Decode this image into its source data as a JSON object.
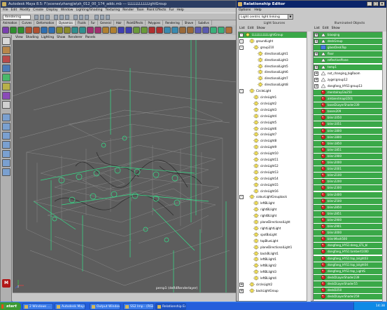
{
  "maya": {
    "title": "Autodesk Maya 8.5: F:\\scenes\\zhangjie\\sh_012_00_174_addc.mb  ---  LLLLLLLLLLLightGroup",
    "menus": [
      "File",
      "Edit",
      "Modify",
      "Create",
      "Display",
      "Window",
      "Lighting/Shading",
      "Texturing",
      "Render",
      "Toon",
      "Paint Effects",
      "Fur",
      "Help"
    ],
    "mode": "Rendering",
    "shelf_tabs": [
      "Animation",
      "Curves",
      "Deformation",
      "Dynamics",
      "Fluids",
      "Fur",
      "General",
      "Hair",
      "PaintEffects",
      "Polygons",
      "Rendering",
      "Shave",
      "Subdivs"
    ],
    "active_shelf_tab": "Dynamics",
    "panel_menus": [
      "View",
      "Shading",
      "Lighting",
      "Show",
      "Renderer",
      "Panels"
    ],
    "camera_label": "persp1 (deR4Renderlayer)",
    "axis_label": "z"
  },
  "relationship_editor": {
    "title": "Relationship Editor",
    "menus": [
      "Options",
      "Help"
    ],
    "mode": "Light centric light linking",
    "left_pane": {
      "title": "Light Sources",
      "menus": [
        "List",
        "Edit",
        "Show"
      ],
      "items": [
        {
          "label": "LLLLLLLLLLLightGroup",
          "depth": 0,
          "expand": "-",
          "selected": true
        },
        {
          "label": "groundLight",
          "depth": 1,
          "expand": "-",
          "selected": false
        },
        {
          "label": "group210",
          "depth": 2,
          "expand": "-",
          "selected": false
        },
        {
          "label": "directionalLight1",
          "depth": 3,
          "expand": "",
          "selected": false
        },
        {
          "label": "directionalLight3",
          "depth": 3,
          "expand": "",
          "selected": false
        },
        {
          "label": "directionalLight5",
          "depth": 3,
          "expand": "",
          "selected": false
        },
        {
          "label": "directionalLight6",
          "depth": 3,
          "expand": "",
          "selected": false
        },
        {
          "label": "directionalLight7",
          "depth": 3,
          "expand": "",
          "selected": false
        },
        {
          "label": "directionalLight8",
          "depth": 3,
          "expand": "",
          "selected": false
        },
        {
          "label": "CircleLight",
          "depth": 1,
          "expand": "-",
          "selected": false
        },
        {
          "label": "circleLight1",
          "depth": 2,
          "expand": "",
          "selected": false
        },
        {
          "label": "circleLight2",
          "depth": 2,
          "expand": "",
          "selected": false
        },
        {
          "label": "circleLight3",
          "depth": 2,
          "expand": "",
          "selected": false
        },
        {
          "label": "circleLight4",
          "depth": 2,
          "expand": "",
          "selected": false
        },
        {
          "label": "circleLight5",
          "depth": 2,
          "expand": "",
          "selected": false
        },
        {
          "label": "circleLight6",
          "depth": 2,
          "expand": "",
          "selected": false
        },
        {
          "label": "circleLight7",
          "depth": 2,
          "expand": "",
          "selected": false
        },
        {
          "label": "circleLight8",
          "depth": 2,
          "expand": "",
          "selected": false
        },
        {
          "label": "circleLight9",
          "depth": 2,
          "expand": "",
          "selected": false
        },
        {
          "label": "circleLight10",
          "depth": 2,
          "expand": "",
          "selected": false
        },
        {
          "label": "circleLight11",
          "depth": 2,
          "expand": "",
          "selected": false
        },
        {
          "label": "circleLight12",
          "depth": 2,
          "expand": "",
          "selected": false
        },
        {
          "label": "circleLight13",
          "depth": 2,
          "expand": "",
          "selected": false
        },
        {
          "label": "circleLight14",
          "depth": 2,
          "expand": "",
          "selected": false
        },
        {
          "label": "circleLight15",
          "depth": 2,
          "expand": "",
          "selected": false
        },
        {
          "label": "circleLight16",
          "depth": 2,
          "expand": "",
          "selected": false
        },
        {
          "label": "colourLightGroupback",
          "depth": 1,
          "expand": "-",
          "selected": false
        },
        {
          "label": "leftBLlight",
          "depth": 2,
          "expand": "",
          "selected": false
        },
        {
          "label": "rightBLlight",
          "depth": 2,
          "expand": "",
          "selected": false
        },
        {
          "label": "rightBLlight",
          "depth": 2,
          "expand": "",
          "selected": false
        },
        {
          "label": "planeDirectionalLight",
          "depth": 2,
          "expand": "",
          "selected": false
        },
        {
          "label": "rightLightLight",
          "depth": 2,
          "expand": "",
          "selected": false
        },
        {
          "label": "spotBaLight",
          "depth": 2,
          "expand": "",
          "selected": false
        },
        {
          "label": "topBlueLight",
          "depth": 2,
          "expand": "",
          "selected": false
        },
        {
          "label": "planeDirectionalLight1",
          "depth": 2,
          "expand": "",
          "selected": false
        },
        {
          "label": "backBLlight1",
          "depth": 2,
          "expand": "",
          "selected": false
        },
        {
          "label": "leftBLlight1",
          "depth": 2,
          "expand": "",
          "selected": false
        },
        {
          "label": "leftBLlight2",
          "depth": 2,
          "expand": "",
          "selected": false
        },
        {
          "label": "leftBLlight3",
          "depth": 2,
          "expand": "",
          "selected": false
        },
        {
          "label": "leftBLlight4",
          "depth": 2,
          "expand": "",
          "selected": false
        },
        {
          "label": "circleLight2",
          "depth": 1,
          "expand": "+",
          "selected": false
        },
        {
          "label": "backLightGroup",
          "depth": 1,
          "expand": "+",
          "selected": false
        }
      ]
    },
    "right_pane": {
      "title": "Illuminated Objects",
      "menus": [
        "List",
        "Edit",
        "Show"
      ],
      "items": [
        {
          "label": "biaoqing",
          "icon": "mesh",
          "expand": "+",
          "selected": true
        },
        {
          "label": "deskGroup",
          "icon": "mesh",
          "expand": "+",
          "selected": true
        },
        {
          "label": "glassDeskTop",
          "icon": "mesh-blue",
          "expand": "",
          "selected": true
        },
        {
          "label": "floor",
          "icon": "mesh",
          "expand": "+",
          "selected": true
        },
        {
          "label": "reflectivePlane",
          "icon": "mesh",
          "expand": "",
          "selected": true
        },
        {
          "label": "temp1",
          "icon": "mesh",
          "expand": "+",
          "selected": true
        },
        {
          "label": "not_changing_bigRoom",
          "icon": "mesh",
          "expand": "+",
          "selected": false
        },
        {
          "label": "zygel:group12",
          "icon": "mesh",
          "expand": "+",
          "selected": false
        },
        {
          "label": "dongfang_HYS1:group13",
          "icon": "mesh",
          "expand": "+",
          "selected": false
        },
        {
          "label": "mentalrayGlo250",
          "icon": "shader",
          "expand": "",
          "selected": true
        },
        {
          "label": "ambientmapG501",
          "icon": "shader",
          "expand": "",
          "selected": true
        },
        {
          "label": "baseDLayerShader239",
          "icon": "shader",
          "expand": "",
          "selected": true
        },
        {
          "label": "bases209",
          "icon": "shader",
          "expand": "",
          "selected": true
        },
        {
          "label": "blinn1050",
          "icon": "shader",
          "expand": "",
          "selected": true
        },
        {
          "label": "blinn1051",
          "icon": "shader",
          "expand": "",
          "selected": true
        },
        {
          "label": "blinn1800",
          "icon": "shader",
          "expand": "",
          "selected": true
        },
        {
          "label": "blinn1800",
          "icon": "shader",
          "expand": "",
          "selected": true
        },
        {
          "label": "blinn1850",
          "icon": "shader",
          "expand": "",
          "selected": true
        },
        {
          "label": "blinn1851",
          "icon": "shader",
          "expand": "",
          "selected": true
        },
        {
          "label": "blinn1900",
          "icon": "shader",
          "expand": "",
          "selected": true
        },
        {
          "label": "blinn2000",
          "icon": "shader",
          "expand": "",
          "selected": true
        },
        {
          "label": "blinn2001",
          "icon": "shader",
          "expand": "",
          "selected": true
        },
        {
          "label": "blinn2100",
          "icon": "shader",
          "expand": "",
          "selected": true
        },
        {
          "label": "blinn2200",
          "icon": "shader",
          "expand": "",
          "selected": true
        },
        {
          "label": "blinn2300",
          "icon": "shader",
          "expand": "",
          "selected": true
        },
        {
          "label": "blinn2400",
          "icon": "shader",
          "expand": "",
          "selected": true
        },
        {
          "label": "blinn2500",
          "icon": "shader",
          "expand": "",
          "selected": true
        },
        {
          "label": "blinn2850",
          "icon": "shader",
          "expand": "",
          "selected": true
        },
        {
          "label": "blinn2851",
          "icon": "shader",
          "expand": "",
          "selected": true
        },
        {
          "label": "blinn2900",
          "icon": "shader",
          "expand": "",
          "selected": true
        },
        {
          "label": "blinn2901",
          "icon": "shader",
          "expand": "",
          "selected": true
        },
        {
          "label": "blinn3000",
          "icon": "shader",
          "expand": "",
          "selected": true
        },
        {
          "label": "blinnMash500",
          "icon": "shader",
          "expand": "",
          "selected": true
        },
        {
          "label": "dongfang_HYS1:deng_LTS_bl",
          "icon": "shader",
          "expand": "",
          "selected": true
        },
        {
          "label": "dongfang_HYS1:lambert1000",
          "icon": "shader",
          "expand": "",
          "selected": true
        },
        {
          "label": "dongfang_HYS1:top_bilght03",
          "icon": "shader",
          "expand": "",
          "selected": true
        },
        {
          "label": "dongfang_HYS1:top_bilght04",
          "icon": "shader",
          "expand": "",
          "selected": true
        },
        {
          "label": "dongfang_HYS1:top_LightS",
          "icon": "shader",
          "expand": "",
          "selected": true
        },
        {
          "label": "deskDLayerShader239",
          "icon": "shader",
          "expand": "",
          "selected": true
        },
        {
          "label": "deskDLayerShader55",
          "icon": "shader",
          "expand": "",
          "selected": true
        },
        {
          "label": "deskD250",
          "icon": "shader",
          "expand": "",
          "selected": true
        },
        {
          "label": "deskDLayerShader259",
          "icon": "shader",
          "expand": "",
          "selected": true
        }
      ]
    }
  },
  "taskbar": {
    "start_label": "start",
    "tasks": [
      {
        "label": "2 Windows ...",
        "active": false
      },
      {
        "label": "Autodesk Maya 8...",
        "active": false
      },
      {
        "label": "Output Window",
        "active": false
      },
      {
        "label": "SS2 Imp - (RGB)",
        "active": false
      },
      {
        "label": "Relationship Edi...",
        "active": true
      }
    ],
    "clock": "14:38"
  },
  "colors": {
    "selected_row": "#3aa848",
    "viewport_bg": "#5d5d5d",
    "light_gizmo": "#35e08a",
    "title_active": "#0a246a"
  }
}
